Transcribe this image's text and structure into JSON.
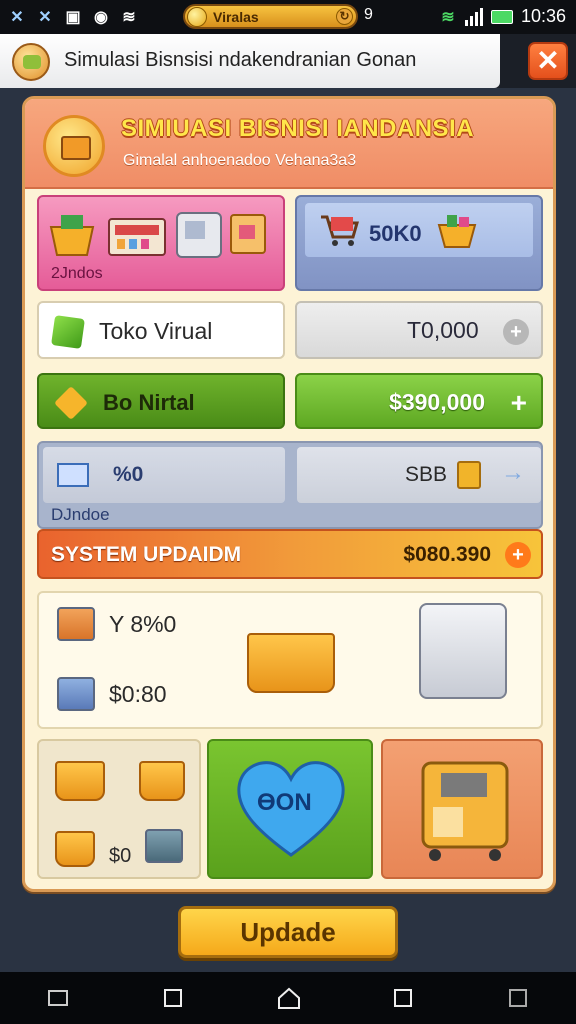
{
  "status_bar": {
    "coin_label": "Viralas",
    "number": "9",
    "time": "10:36"
  },
  "app_header": {
    "title": "Simulasi Bisnsisi  ndakendranian Gonan"
  },
  "panel": {
    "title": "SIMIUASI BISNISI IANDANSIA",
    "subtitle": "Gimalal anhoenadoo Vehana3a3",
    "tile_pink": {
      "label": "2Jndos"
    },
    "tile_blue": {
      "value": "50K0"
    },
    "toko": {
      "label": "Toko Virual"
    },
    "toko_value": {
      "value": "T0,000"
    },
    "bo": {
      "label": "Bo Nirtal"
    },
    "bo_value": {
      "value": "$390,000"
    },
    "stat_left": {
      "value": "%0"
    },
    "stat_right": {
      "value": "SBB"
    },
    "strip_label": "DJndoe",
    "system": {
      "label": "SYSTEM UPDAIDM",
      "value": "$080.390"
    },
    "info": {
      "line1": "Y 8%0",
      "line2": "$0:80"
    },
    "bottom_left": {
      "value": "$0"
    },
    "heart": {
      "label": "ӨON"
    }
  },
  "update_button": "Updade",
  "icons": [
    "signal-icon",
    "wifi-icon",
    "battery-icon",
    "close-icon",
    "plus-icon",
    "arrow-right-icon",
    "home-icon",
    "back-icon",
    "recent-apps-icon",
    "gallery-icon"
  ],
  "colors": {
    "panel_header": "#f08d66",
    "title_yellow": "#ffe64a",
    "green": "#5ea822",
    "pink": "#e55c98",
    "orange": "#e9632e",
    "button_gold": "#f5a91a"
  }
}
